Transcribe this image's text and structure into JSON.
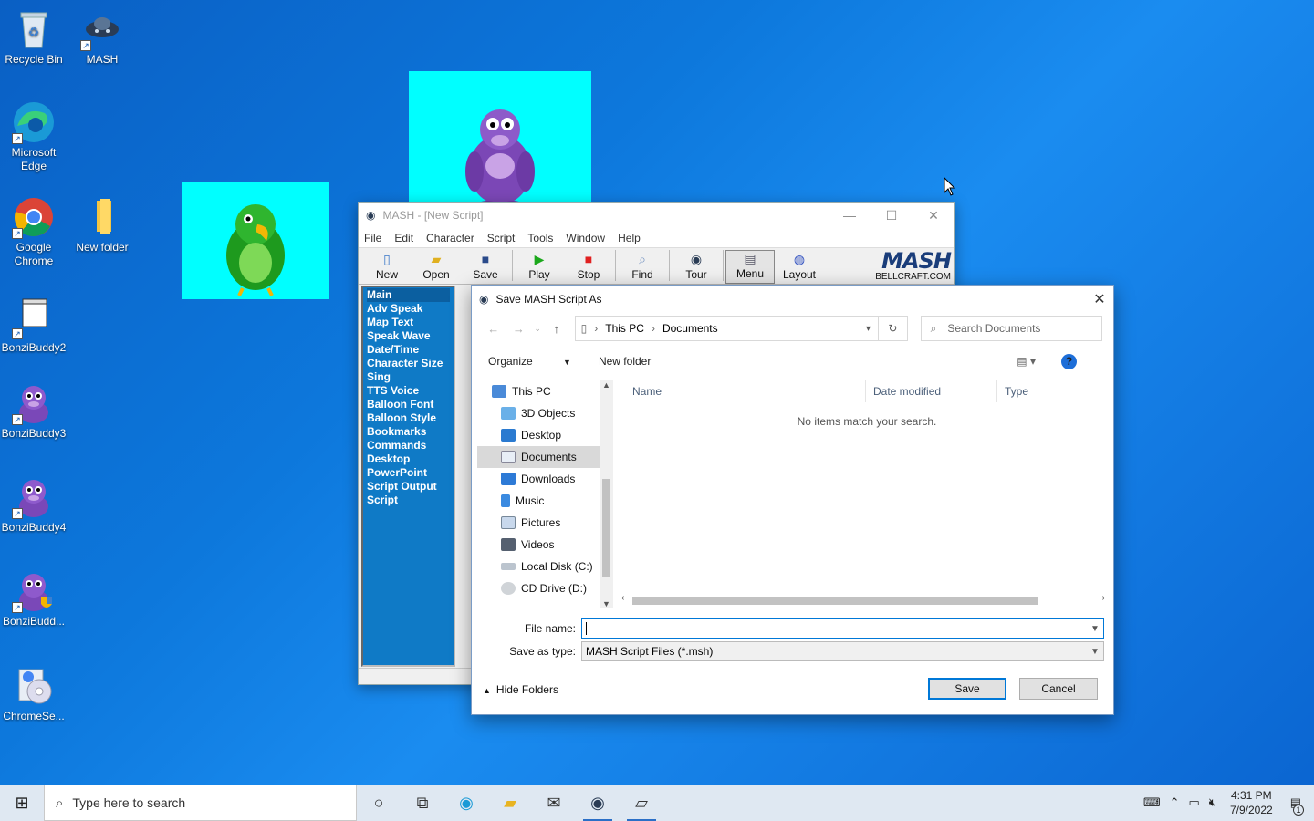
{
  "desktop": {
    "icons": [
      {
        "label": "Recycle Bin"
      },
      {
        "label": "MASH"
      },
      {
        "label": "Microsoft Edge"
      },
      {
        "label": "Google Chrome"
      },
      {
        "label": "New folder"
      },
      {
        "label": "BonziBuddy2"
      },
      {
        "label": "BonziBuddy3"
      },
      {
        "label": "BonziBuddy4"
      },
      {
        "label": "BonziBudd..."
      },
      {
        "label": "ChromeSe..."
      }
    ]
  },
  "mash": {
    "title": "MASH - [New Script]",
    "menus": [
      "File",
      "Edit",
      "Character",
      "Script",
      "Tools",
      "Window",
      "Help"
    ],
    "toolbar": [
      "New",
      "Open",
      "Save",
      "Play",
      "Stop",
      "Find",
      "Tour",
      "Menu",
      "Layout"
    ],
    "logo": {
      "brand": "MASH",
      "site": "BELLCRAFT.COM"
    },
    "side_items": [
      "Main",
      "Adv Speak",
      "Map Text",
      "Speak Wave",
      "Date/Time",
      "Character Size",
      "Sing",
      "TTS Voice",
      "Balloon Font",
      "Balloon Style",
      "Bookmarks",
      "Commands",
      "Desktop",
      "PowerPoint",
      "Script Output",
      "Script"
    ]
  },
  "dialog": {
    "title": "Save MASH Script As",
    "breadcrumb": [
      "This PC",
      "Documents"
    ],
    "search_placeholder": "Search Documents",
    "organize": "Organize",
    "new_folder": "New folder",
    "tree": [
      "This PC",
      "3D Objects",
      "Desktop",
      "Documents",
      "Downloads",
      "Music",
      "Pictures",
      "Videos",
      "Local Disk (C:)",
      "CD Drive (D:)"
    ],
    "columns": [
      "Name",
      "Date modified",
      "Type"
    ],
    "empty_message": "No items match your search.",
    "file_name_label": "File name:",
    "file_name_value": "",
    "save_type_label": "Save as type:",
    "save_type_value": "MASH Script Files (*.msh)",
    "hide_folders": "Hide Folders",
    "save_button": "Save",
    "cancel_button": "Cancel"
  },
  "taskbar": {
    "search_placeholder": "Type here to search",
    "time": "4:31 PM",
    "date": "7/9/2022",
    "notification_count": "1"
  }
}
